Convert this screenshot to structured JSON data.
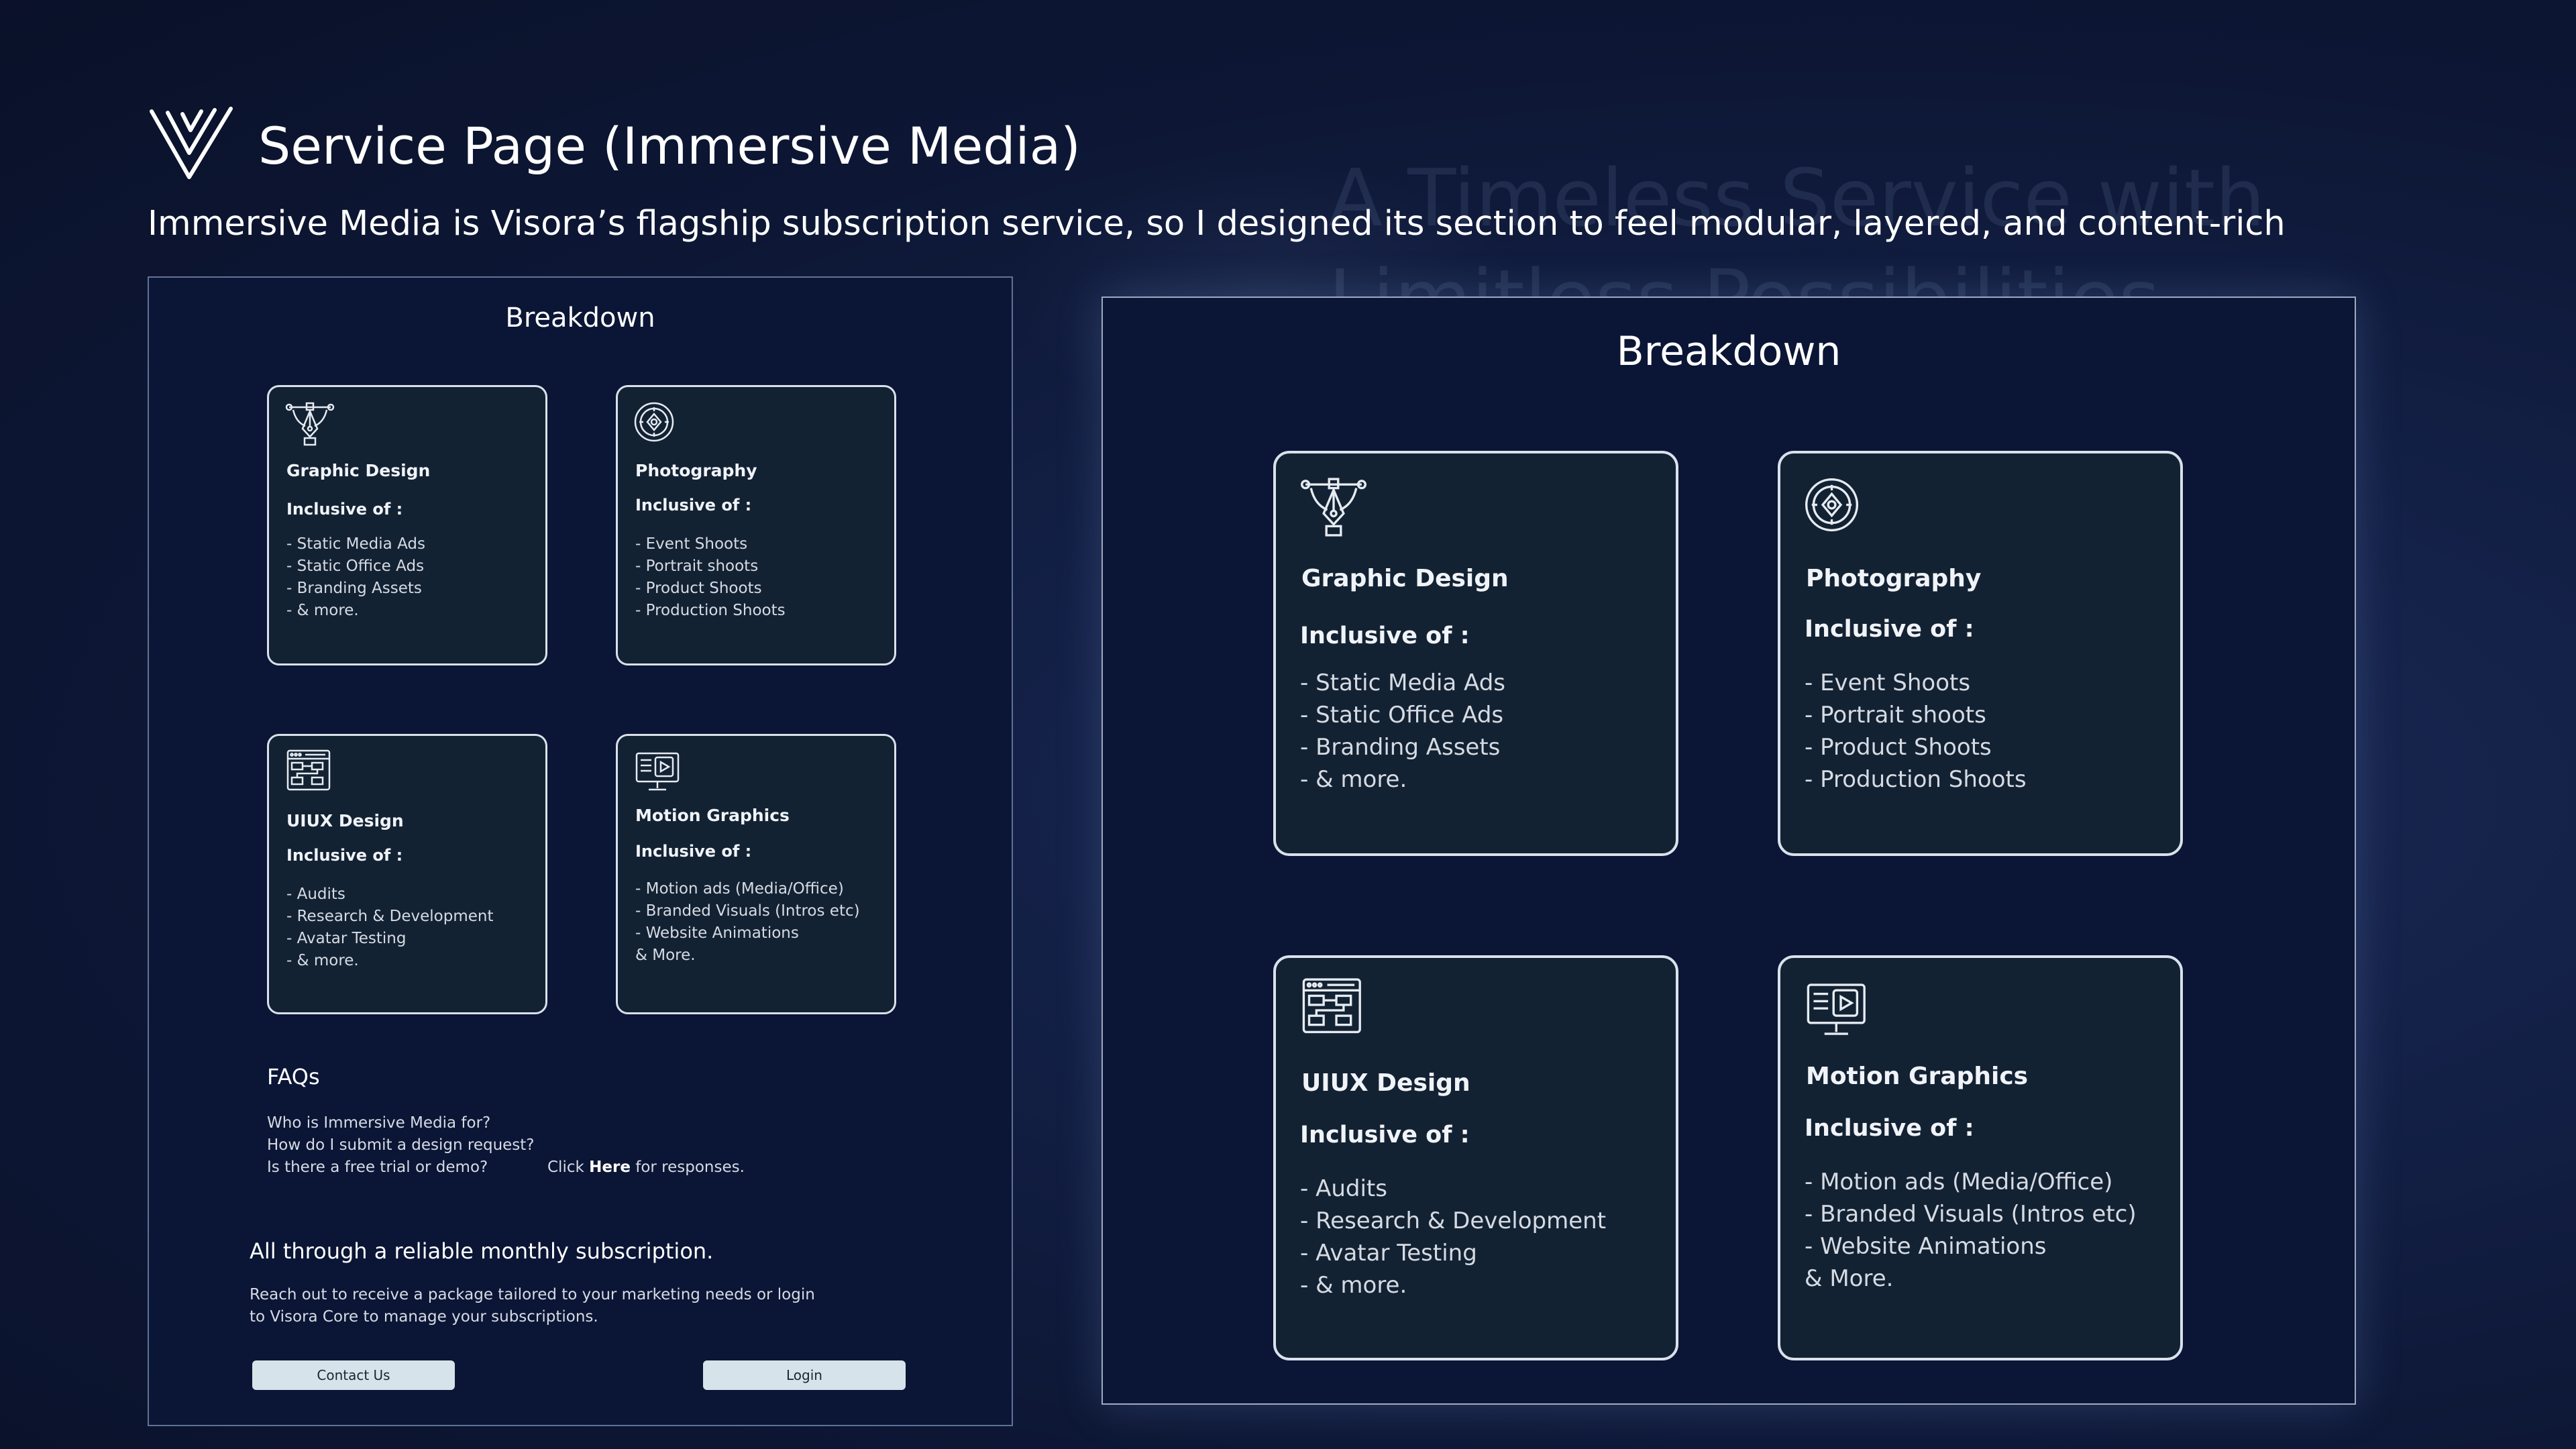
{
  "background_text": {
    "line1": "A Timeless Service with",
    "line2": "Limitless Possibilities"
  },
  "header": {
    "logo_icon": "visora-v-logo-icon",
    "title": "Service Page (Immersive Media)",
    "subtitle": "Immersive Media is Visora’s flagship subscription service, so I designed its section to feel modular, layered, and content-rich"
  },
  "breakdown_title": "Breakdown",
  "inclusive_label": "Inclusive of :",
  "cards": [
    {
      "icon": "pen-tool-icon",
      "title": "Graphic Design",
      "items": [
        "- Static Media Ads",
        "- Static Office Ads",
        "- Branding Assets",
        "- & more."
      ]
    },
    {
      "icon": "camera-lens-icon",
      "title": "Photography",
      "items": [
        "- Event Shoots",
        "- Portrait shoots",
        "- Product Shoots",
        "- Production Shoots"
      ]
    },
    {
      "icon": "wireframe-icon",
      "title": "UIUX Design",
      "items": [
        "- Audits",
        "- Research & Development",
        "- Avatar Testing",
        "- & more."
      ]
    },
    {
      "icon": "monitor-play-icon",
      "title": "Motion Graphics",
      "items": [
        "- Motion ads (Media/Office)",
        "- Branded Visuals (Intros etc)",
        "- Website Animations",
        "& More."
      ]
    }
  ],
  "faqs": {
    "title": "FAQs",
    "questions": [
      "Who is Immersive Media for?",
      "How do I submit a design request?",
      "Is there a free trial or demo?"
    ],
    "click_prefix": "Click ",
    "click_link": "Here",
    "click_suffix": " for responses."
  },
  "subscription": {
    "heading": "All through a reliable monthly subscription.",
    "text_line1": "Reach out to receive a package tailored to your marketing needs or login",
    "text_line2": "to Visora Core to manage your subscriptions."
  },
  "buttons": {
    "contact": "Contact Us",
    "login": "Login"
  },
  "colors": {
    "background": "#0d1735",
    "panel": "#0b1636",
    "card": "#132233",
    "card_border": "#d9e1ec",
    "button": "#d6e3ea"
  }
}
